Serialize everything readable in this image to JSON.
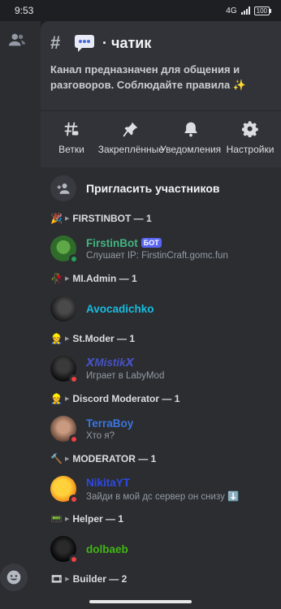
{
  "status_bar": {
    "time": "9:53",
    "network": "4G",
    "battery": "100"
  },
  "channel": {
    "title": "· чатик",
    "topic": "Канал предназначен для общения и разговоров. Соблюдайте правила ✨"
  },
  "actions": [
    {
      "label": "Ветки",
      "icon": "threads-icon"
    },
    {
      "label": "Закреплённые",
      "icon": "pin-icon"
    },
    {
      "label": "Уведомления",
      "icon": "bell-icon"
    },
    {
      "label": "Настройки",
      "icon": "gear-icon"
    }
  ],
  "invite_label": "Пригласить участников",
  "sections": {
    "firstinbot": {
      "emoji": "🎉",
      "label": "FIRSTINBOT — 1"
    },
    "admin": {
      "emoji": "🥀",
      "label": "MI.Admin — 1"
    },
    "stmoder": {
      "emoji": "👷",
      "label": "St.Moder — 1"
    },
    "discord_moderator": {
      "emoji": "👷",
      "label": "Discord Moderator — 1"
    },
    "moderator": {
      "emoji": "🔨",
      "label": "MODERATOR — 1"
    },
    "helper": {
      "emoji": "📟",
      "label": "Helper — 1"
    },
    "builder": {
      "emoji": "🎞",
      "label": "Builder — 2"
    }
  },
  "members": {
    "firstinbot": {
      "name": "FirstinBot",
      "badge": "БОТ",
      "sub": "Слушает IP: FirstinCraft.gomc.fun",
      "color": "#43b581"
    },
    "avocadichko": {
      "name": "Avocadichko",
      "color": "#1abcde"
    },
    "mistik": {
      "name": "ⅩMistikⅩ",
      "sub": "Играет в LabyMod",
      "color": "#4752c4"
    },
    "terraboy": {
      "name": "TerraBoy",
      "sub": "Хто я?",
      "color": "#3a76e0"
    },
    "nikitayt": {
      "name": "NikitaYT",
      "sub": "Зайди в мой дс сервер он снизу ⬇️",
      "color": "#2f4ae0"
    },
    "dolbaeb": {
      "name": "dolbaeb",
      "color": "#43b514"
    }
  },
  "colors": {
    "online": "#23a559",
    "dnd": "#f23f43",
    "idle": "#f0b232"
  }
}
